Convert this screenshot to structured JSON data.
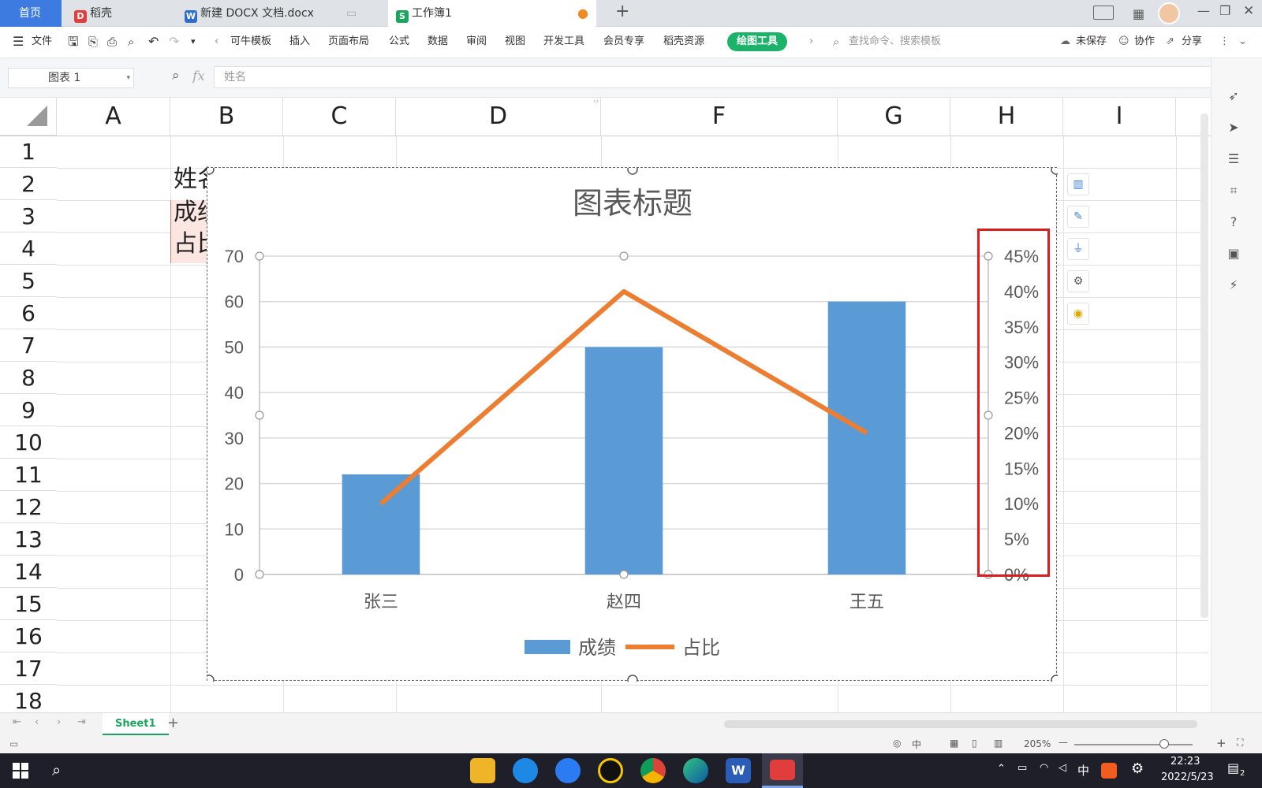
{
  "tabs": [
    {
      "label": "首页",
      "active": true
    },
    {
      "label": "稻壳"
    },
    {
      "label": "新建 DOCX 文档.docx"
    },
    {
      "label": "工作簿1"
    }
  ],
  "new_tab_icon": "plus-icon",
  "menu": {
    "file": "文件",
    "items": [
      "可牛模板",
      "插入",
      "页面布局",
      "公式",
      "数据",
      "审阅",
      "视图",
      "开发工具",
      "会员专享",
      "稻壳资源"
    ],
    "drawing_tools": "绘图工具",
    "search_placeholder": "查找命令、搜索模板",
    "unsaved": "未保存",
    "collab": "协作",
    "share": "分享"
  },
  "formula": {
    "name_box": "图表 1",
    "fx": "fx",
    "value": "姓名"
  },
  "columns": [
    "A",
    "B",
    "C",
    "D",
    "F",
    "G",
    "H",
    "I"
  ],
  "rows": [
    "1",
    "2",
    "3",
    "4",
    "5",
    "6",
    "7",
    "8",
    "9",
    "10",
    "11",
    "12",
    "13",
    "14",
    "15",
    "16",
    "17",
    "18"
  ],
  "cells": {
    "B2": "姓名",
    "B3": "成绩",
    "B4": "占比"
  },
  "chart_data": {
    "type": "bar+line",
    "title": "图表标题",
    "categories": [
      "张三",
      "赵四",
      "王五"
    ],
    "series": [
      {
        "name": "成绩",
        "type": "bar",
        "axis": "left",
        "values": [
          22,
          50,
          60
        ],
        "color": "#5b9bd5"
      },
      {
        "name": "占比",
        "type": "line",
        "axis": "right",
        "values": [
          0.1,
          0.4,
          0.2
        ],
        "color": "#ed7d31"
      }
    ],
    "left_axis": {
      "ticks": [
        "0",
        "10",
        "20",
        "30",
        "40",
        "50",
        "60",
        "70"
      ],
      "range": [
        0,
        70
      ]
    },
    "right_axis": {
      "ticks": [
        "0%",
        "5%",
        "10%",
        "15%",
        "20%",
        "25%",
        "30%",
        "35%",
        "40%",
        "45%"
      ],
      "range": [
        0,
        0.45
      ]
    },
    "grid": true,
    "legend": "bottom"
  },
  "sheet": {
    "name": "Sheet1"
  },
  "status": {
    "zoom": "205%"
  },
  "clock": {
    "time": "22:23",
    "date": "2022/5/23"
  },
  "tray": {
    "lang": "中",
    "notif": "2"
  }
}
